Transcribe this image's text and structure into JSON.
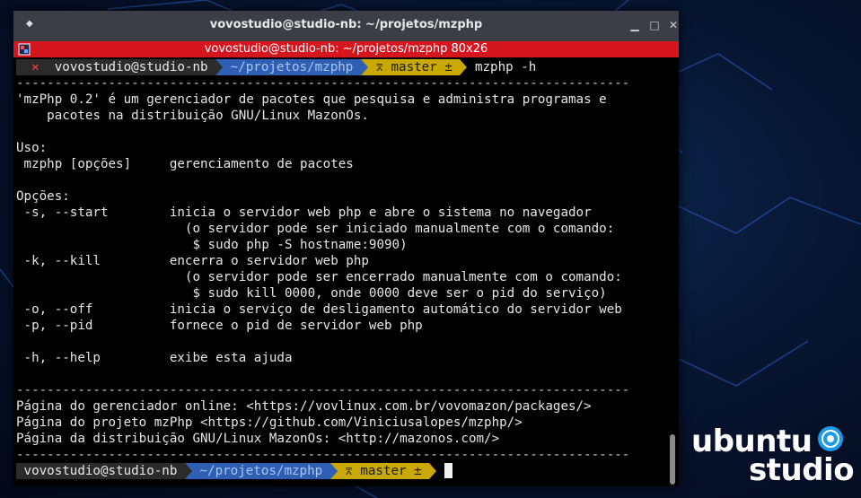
{
  "window": {
    "title": "vovostudio@studio-nb: ~/projetos/mzphp",
    "tab_title": "vovostudio@studio-nb: ~/projetos/mzphp 80x26"
  },
  "icons": {
    "window_menu": "window-menu-icon",
    "minimize": "minimize-icon",
    "maximize": "maximize-icon",
    "close": "close-icon",
    "terminal_tab": "terminal-tab-icon"
  },
  "colors": {
    "tab_bar": "#d6161f",
    "path_segment": "#2f5fb3",
    "git_segment": "#c9a800",
    "titlebar": "#3b3e44"
  },
  "prompt_top": {
    "status": "✕",
    "user": "vovostudio@studio-nb",
    "path": "~/projetos/mzphp",
    "git": "⌆ master ±",
    "command": "mzphp -h"
  },
  "output": {
    "rule": "--------------------------------------------------------------------------------",
    "desc_1": "'mzPhp 0.2' é um gerenciador de pacotes que pesquisa e administra programas e",
    "desc_2": "    pacotes na distribuição GNU/Linux MazonOs.",
    "usage_header": "Uso:",
    "usage_line": " mzphp [opções]     gerenciamento de pacotes",
    "options_header": "Opções:",
    "opt_start": " -s, --start        inicia o servidor web php e abre o sistema no navegador",
    "opt_start_2": "                      (o servidor pode ser iniciado manualmente com o comando:",
    "opt_start_3": "                       $ sudo php -S hostname:9090)",
    "opt_kill": " -k, --kill         encerra o servidor web php",
    "opt_kill_2": "                      (o servidor pode ser encerrado manualmente com o comando:",
    "opt_kill_3": "                       $ sudo kill 0000, onde 0000 deve ser o pid do serviço)",
    "opt_off": " -o, --off          inicia o serviço de desligamento automático do servidor web",
    "opt_pid": " -p, --pid          fornece o pid de servidor web php",
    "opt_help": " -h, --help         exibe esta ajuda",
    "link_1": "Página do gerenciador online: <https://vovlinux.com.br/vovomazon/packages/>",
    "link_2": "Página do projeto mzPhp <https://github.com/Viniciusalopes/mzphp/>",
    "link_3": "Página da distribuição GNU/Linux MazonOs: <http://mazonos.com/>"
  },
  "prompt_bottom": {
    "user": "vovostudio@studio-nb",
    "path": "~/projetos/mzphp",
    "git": "⌆ master ±"
  },
  "desktop_logo": {
    "word1": "ubuntu",
    "word2": "studio"
  }
}
